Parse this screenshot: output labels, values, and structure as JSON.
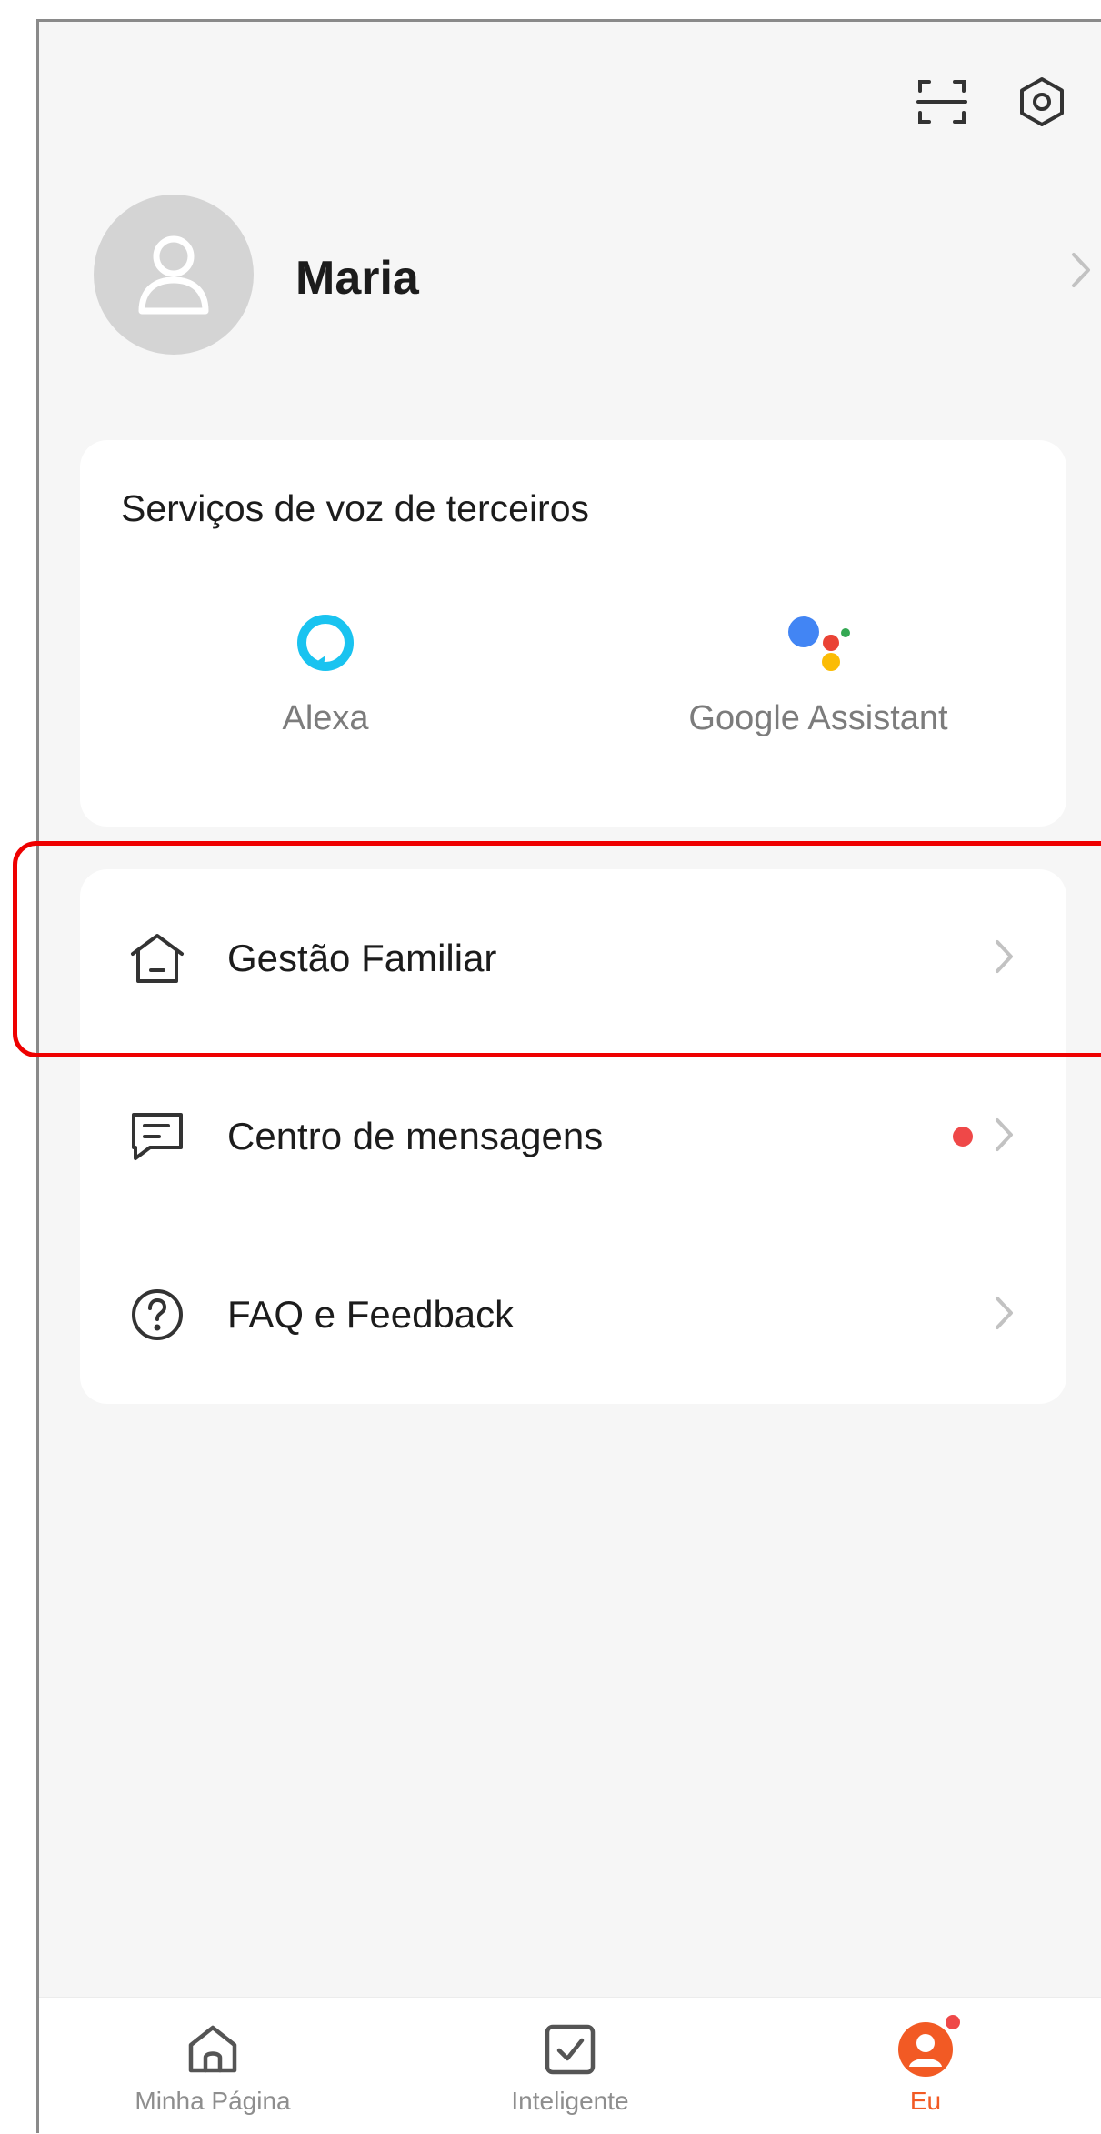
{
  "profile": {
    "name": "Maria"
  },
  "voice_services": {
    "title": "Serviços de voz de terceiros",
    "items": [
      {
        "label": "Alexa",
        "icon": "alexa-icon"
      },
      {
        "label": "Google Assistant",
        "icon": "google-assistant-icon"
      }
    ]
  },
  "menu": {
    "items": [
      {
        "label": "Gestão Familiar",
        "icon": "home-icon",
        "badge": false
      },
      {
        "label": "Centro de mensagens",
        "icon": "message-icon",
        "badge": true
      },
      {
        "label": "FAQ e Feedback",
        "icon": "help-circle-icon",
        "badge": false
      }
    ]
  },
  "tabbar": {
    "tabs": [
      {
        "label": "Minha Página",
        "icon": "home-tab-icon",
        "active": false
      },
      {
        "label": "Inteligente",
        "icon": "checkbox-tab-icon",
        "active": false
      },
      {
        "label": "Eu",
        "icon": "profile-tab-icon",
        "active": true
      }
    ]
  },
  "colors": {
    "accent": "#f25a24",
    "badge": "#ef4848",
    "highlight": "#ee0000",
    "background": "#f6f6f6",
    "alexa": "#19c3f0"
  }
}
